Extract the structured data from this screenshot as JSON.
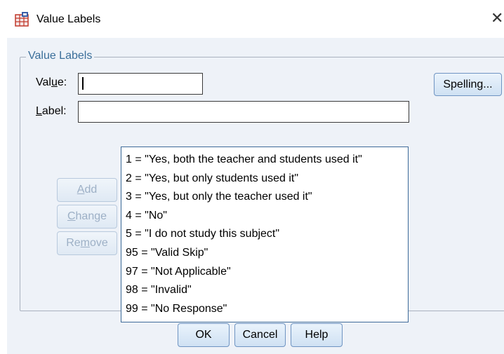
{
  "window": {
    "title": "Value Labels",
    "close_glyph": "✕"
  },
  "group": {
    "legend": "Value Labels"
  },
  "value_field": {
    "label_pre": "Val",
    "label_mnemonic": "u",
    "label_post": "e:",
    "value": ""
  },
  "label_field": {
    "label_mnemonic": "L",
    "label_post": "abel:",
    "value": ""
  },
  "buttons": {
    "spelling": "Spelling...",
    "add": {
      "mnemonic": "A",
      "rest": "dd"
    },
    "change": {
      "mnemonic": "C",
      "rest": "hange"
    },
    "remove": {
      "pre": "Re",
      "mnemonic": "m",
      "rest": "ove"
    },
    "ok": "OK",
    "cancel": "Cancel",
    "help": "Help"
  },
  "labels_list": [
    "1 = \"Yes, both the teacher and students used it\"",
    "2 = \"Yes, but only students used it\"",
    "3 = \"Yes, but only the teacher used it\"",
    "4 = \"No\"",
    "5 = \"I do not study this subject\"",
    "95 = \"Valid Skip\"",
    "97 = \"Not Applicable\"",
    "98 = \"Invalid\"",
    "99 = \"No Response\""
  ],
  "icons": {
    "app": "spss-table-icon",
    "close": "close-icon"
  }
}
